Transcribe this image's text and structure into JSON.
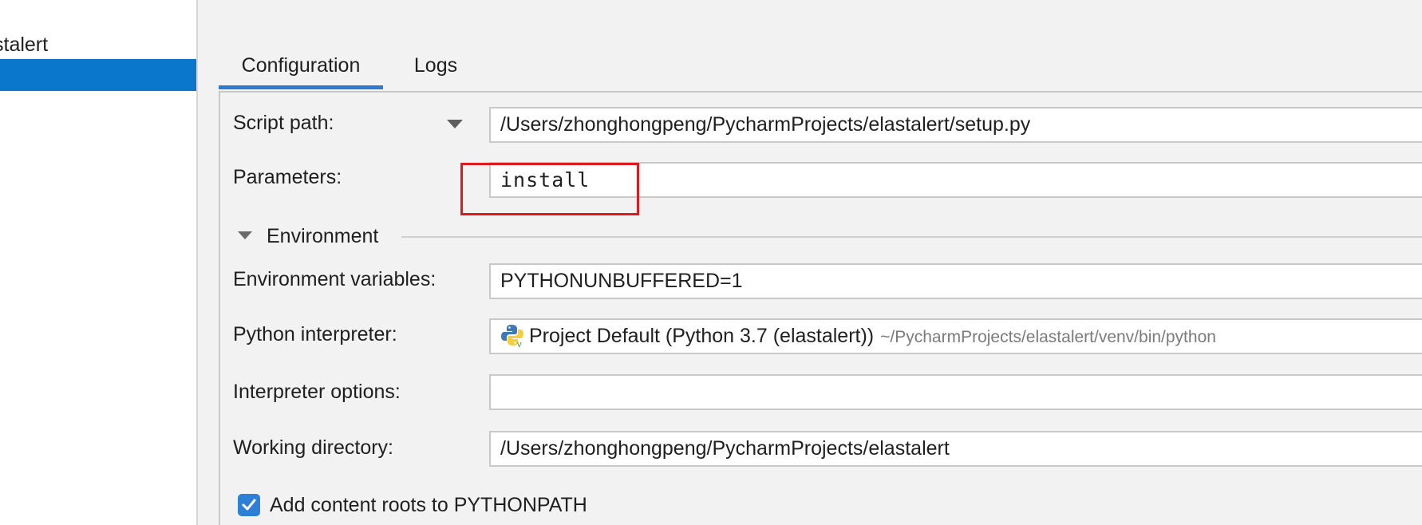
{
  "sidebar": {
    "items": [
      {
        "label": "stalert"
      },
      {
        "label": ""
      }
    ]
  },
  "tabs": [
    {
      "label": "Configuration",
      "active": true
    },
    {
      "label": "Logs",
      "active": false
    }
  ],
  "form": {
    "script_path": {
      "label": "Script path:",
      "value": "/Users/zhonghongpeng/PycharmProjects/elastalert/setup.py"
    },
    "parameters": {
      "label": "Parameters:",
      "value": "install"
    },
    "environment_section": {
      "title": "Environment"
    },
    "env_vars": {
      "label": "Environment variables:",
      "value": "PYTHONUNBUFFERED=1"
    },
    "interpreter": {
      "label": "Python interpreter:",
      "value": "Project Default (Python 3.7 (elastalert))",
      "path": "~/PycharmProjects/elastalert/venv/bin/python",
      "icon": "python-icon"
    },
    "interpreter_options": {
      "label": "Interpreter options:",
      "value": ""
    },
    "working_dir": {
      "label": "Working directory:",
      "value": "/Users/zhonghongpeng/PycharmProjects/elastalert"
    },
    "content_roots": {
      "label": "Add content roots to PYTHONPATH",
      "checked": true
    }
  },
  "colors": {
    "selection": "#0a76cc",
    "tab_underline": "#2d7cd1",
    "highlight_box": "#e0191f",
    "checkbox": "#2e80d6"
  }
}
